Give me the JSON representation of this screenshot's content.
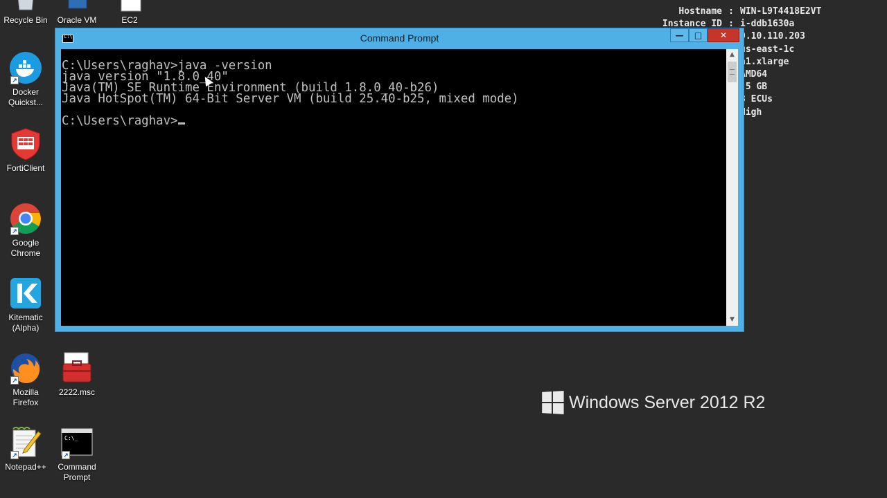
{
  "desktop_icons": [
    {
      "id": "recycle-bin",
      "label_lines": [
        "Recycle Bin"
      ]
    },
    {
      "id": "oracle-vm",
      "label_lines": [
        "Oracle VM"
      ]
    },
    {
      "id": "ec2",
      "label_lines": [
        "EC2"
      ]
    },
    {
      "id": "docker",
      "label_lines": [
        "Docker",
        "Quickst..."
      ]
    },
    {
      "id": "forticlient",
      "label_lines": [
        "FortiClient"
      ]
    },
    {
      "id": "chrome",
      "label_lines": [
        "Google",
        "Chrome"
      ]
    },
    {
      "id": "kitematic",
      "label_lines": [
        "Kitematic",
        "(Alpha)"
      ]
    },
    {
      "id": "firefox",
      "label_lines": [
        "Mozilla",
        "Firefox"
      ]
    },
    {
      "id": "msc",
      "label_lines": [
        "2222.msc"
      ]
    },
    {
      "id": "notepadpp",
      "label_lines": [
        "Notepad++"
      ]
    },
    {
      "id": "cmd",
      "label_lines": [
        "Command",
        "Prompt"
      ]
    }
  ],
  "sysinfo": {
    "rows": [
      {
        "key": "Hostname",
        "value": "WIN-L9T4418E2VT"
      },
      {
        "key": "Instance ID",
        "value": "i-ddb1630a"
      },
      {
        "key": "",
        "value": "0.10.110.203"
      },
      {
        "key": "",
        "value": "us-east-1c"
      },
      {
        "key": "",
        "value": "n1.xlarge"
      },
      {
        "key": "",
        "value": "AMD64"
      },
      {
        "key": "",
        "value": ".5 GB"
      },
      {
        "key": "",
        "value": "8 ECUs"
      },
      {
        "key": "",
        "value": "High"
      }
    ]
  },
  "brand": {
    "text": "Windows Server 2012 R2"
  },
  "cmd_window": {
    "title": "Command Prompt",
    "minimize": "—",
    "maximize": "□",
    "close": "✕",
    "lines": [
      "C:\\Users\\raghav>java -version",
      "java version \"1.8.0_40\"",
      "Java(TM) SE Runtime Environment (build 1.8.0_40-b26)",
      "Java HotSpot(TM) 64-Bit Server VM (build 25.40-b25, mixed mode)",
      "",
      "C:\\Users\\raghav>"
    ]
  },
  "colors": {
    "desktop": "#2a2a2a",
    "window_frame": "#4fb0e6",
    "close_button": "#c7352a",
    "console_bg": "#000000",
    "console_fg": "#c0c0c0"
  }
}
